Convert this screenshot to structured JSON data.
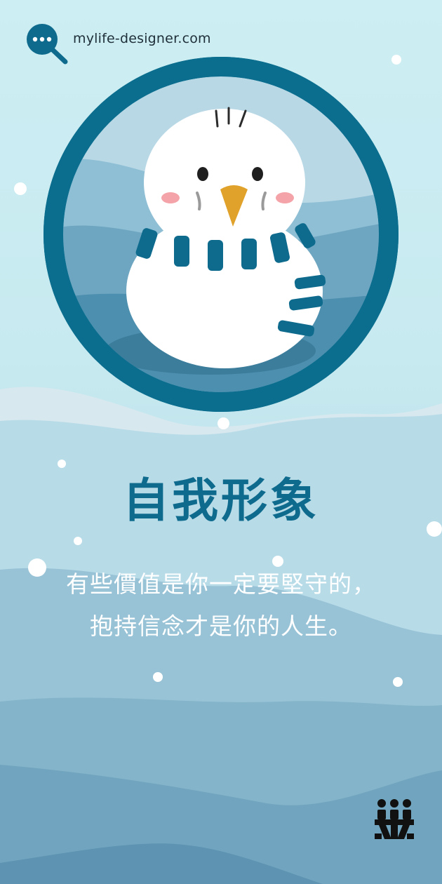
{
  "site": {
    "url": "mylife-designer.com"
  },
  "card": {
    "title": "自我形象",
    "quote_line1": "有些價值是你一定要堅守的，",
    "quote_line2": "抱持信念才是你的人生。"
  },
  "colors": {
    "primary": "#0e6b8d",
    "ring": "#0b6e8e",
    "beak": "#e0a22a",
    "background": "#cdeef3"
  },
  "icons": {
    "brand": "chat-search-icon",
    "illustration": "snowman-bird-illustration",
    "corner": "family-logo-icon"
  }
}
